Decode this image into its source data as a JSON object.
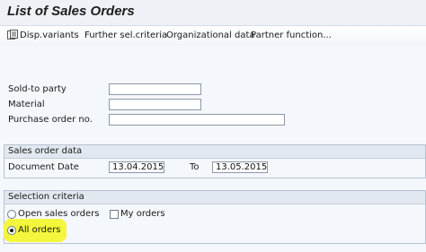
{
  "title": "List of Sales Orders",
  "toolbar": {
    "disp_variants": "Disp.variants",
    "further_sel": "Further sel.criteria",
    "org_data": "Organizational data",
    "partner_function": "Partner function..."
  },
  "fields": {
    "sold_to_party": {
      "label": "Sold-to party",
      "value": ""
    },
    "material": {
      "label": "Material",
      "value": ""
    },
    "purchase_order": {
      "label": "Purchase order no.",
      "value": ""
    }
  },
  "sales_order_data": {
    "header": "Sales order data",
    "document_date_label": "Document Date",
    "date_from": "13.04.2015",
    "to_label": "To",
    "date_to": "13.05.2015"
  },
  "selection_criteria": {
    "header": "Selection criteria",
    "open_orders": "Open sales orders",
    "my_orders": "My orders",
    "all_orders": "All orders",
    "selected": "all_orders"
  },
  "colors": {
    "highlight": "#f2f533",
    "background": "#eef2f7"
  }
}
